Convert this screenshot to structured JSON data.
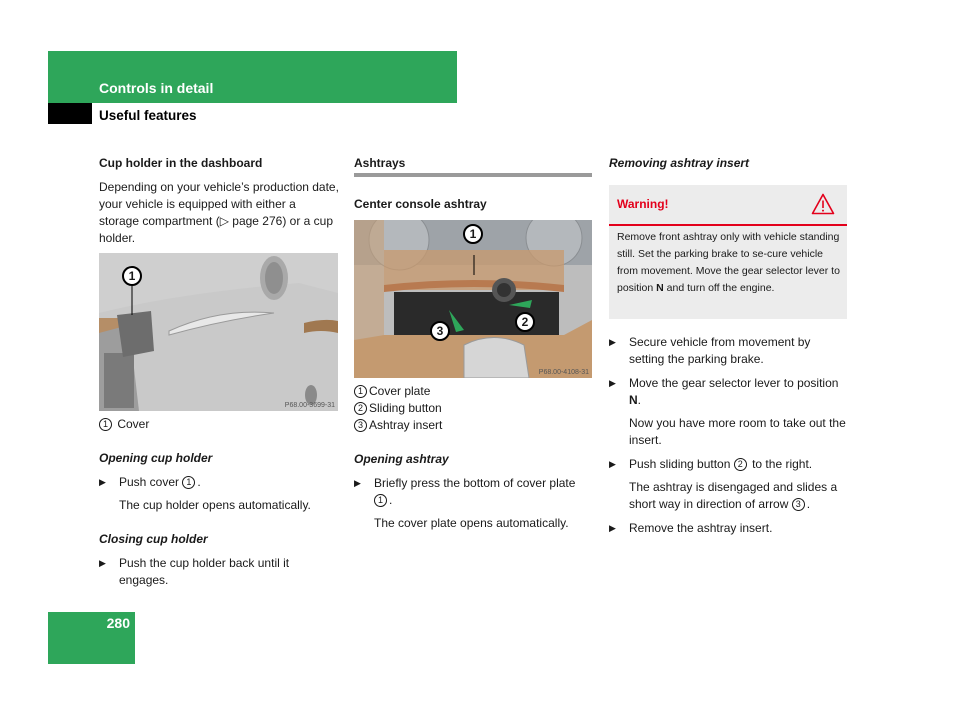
{
  "header": {
    "chapter": "Controls in detail",
    "section": "Useful features"
  },
  "page_number": "280",
  "col1": {
    "title": "Cup holder in the dashboard",
    "intro": "Depending on your vehicle’s production date, your vehicle is equipped with either a storage compartment (▷ page 276) or a cup holder.",
    "image": {
      "callout": "1",
      "code": "P68.00-3699-31"
    },
    "legend": [
      {
        "num": "1",
        "label": "Cover"
      }
    ],
    "opening": {
      "heading": "Opening cup holder",
      "step": "Push cover",
      "step_ref": "1",
      "result": "The cup holder opens automatically."
    },
    "closing": {
      "heading": "Closing cup holder",
      "step": "Push the cup holder back until it engages."
    }
  },
  "col2": {
    "title": "Ashtrays",
    "subtitle": "Center console ashtray",
    "image": {
      "callouts": [
        "1",
        "2",
        "3"
      ],
      "code": "P68.00-4108-31"
    },
    "legend": [
      {
        "num": "1",
        "label": "Cover plate"
      },
      {
        "num": "2",
        "label": "Sliding button"
      },
      {
        "num": "3",
        "label": "Ashtray insert"
      }
    ],
    "opening": {
      "heading": "Opening ashtray",
      "step_a": "Briefly press the bottom of cover plate",
      "step_ref": "1",
      "result": "The cover plate opens automatically."
    }
  },
  "col3": {
    "heading": "Removing ashtray insert",
    "warning": {
      "title": "Warning!",
      "icon": "warning-triangle-icon",
      "text_a": "Remove front ashtray only with vehicle standing still. Set the parking brake to se-cure vehicle from movement. Move the gear selector lever to position",
      "text_bold": "N",
      "text_b": "and turn off the engine."
    },
    "steps": {
      "s1": "Secure vehicle from movement by setting the parking brake.",
      "s2_a": "Move the gear selector lever to position",
      "s2_bold": "N",
      "s2_result": "Now you have more room to take out the insert.",
      "s3_a": "Push sliding button",
      "s3_ref": "2",
      "s3_b": "to the right.",
      "s3_result_a": "The ashtray is disengaged and slides a short way in direction of arrow",
      "s3_result_ref": "3",
      "s4": "Remove the ashtray insert."
    }
  },
  "colors": {
    "brand_green": "#2ea65a",
    "warning_red": "#e3001b"
  }
}
